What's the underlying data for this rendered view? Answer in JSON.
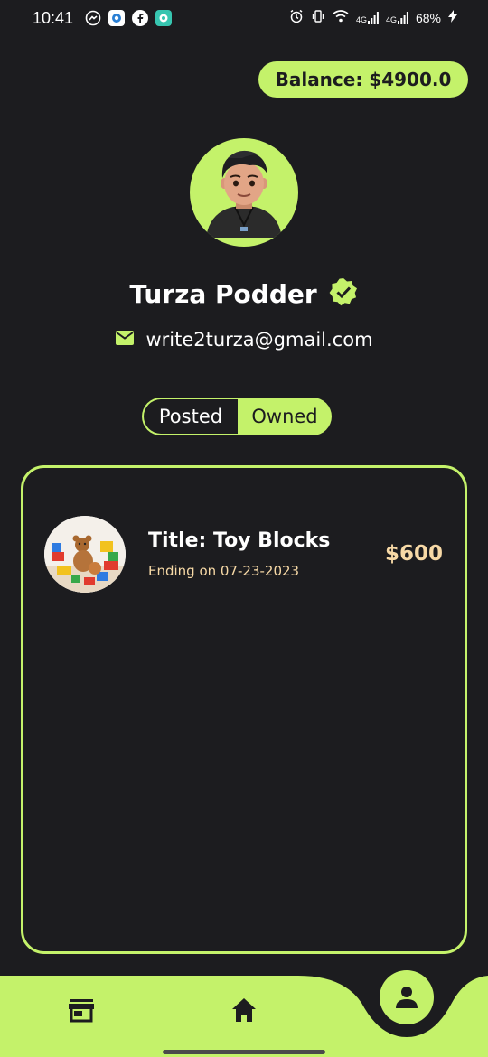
{
  "status": {
    "time": "10:41",
    "battery": "68%",
    "network1": "4G",
    "network2": "4G"
  },
  "balance": "Balance: $4900.0",
  "profile": {
    "name": "Turza Podder",
    "email": "write2turza@gmail.com"
  },
  "tabs": {
    "posted": "Posted",
    "owned": "Owned",
    "active": "Owned"
  },
  "items": [
    {
      "title": "Title: Toy Blocks",
      "ending": "Ending on 07-23-2023",
      "price": "$600"
    }
  ],
  "colors": {
    "accent": "#c4f26a",
    "background": "#1c1c1f",
    "price": "#f7d9a6"
  },
  "nav": {
    "items": [
      "store-icon",
      "home-icon",
      "person-icon"
    ],
    "active": "person-icon"
  }
}
